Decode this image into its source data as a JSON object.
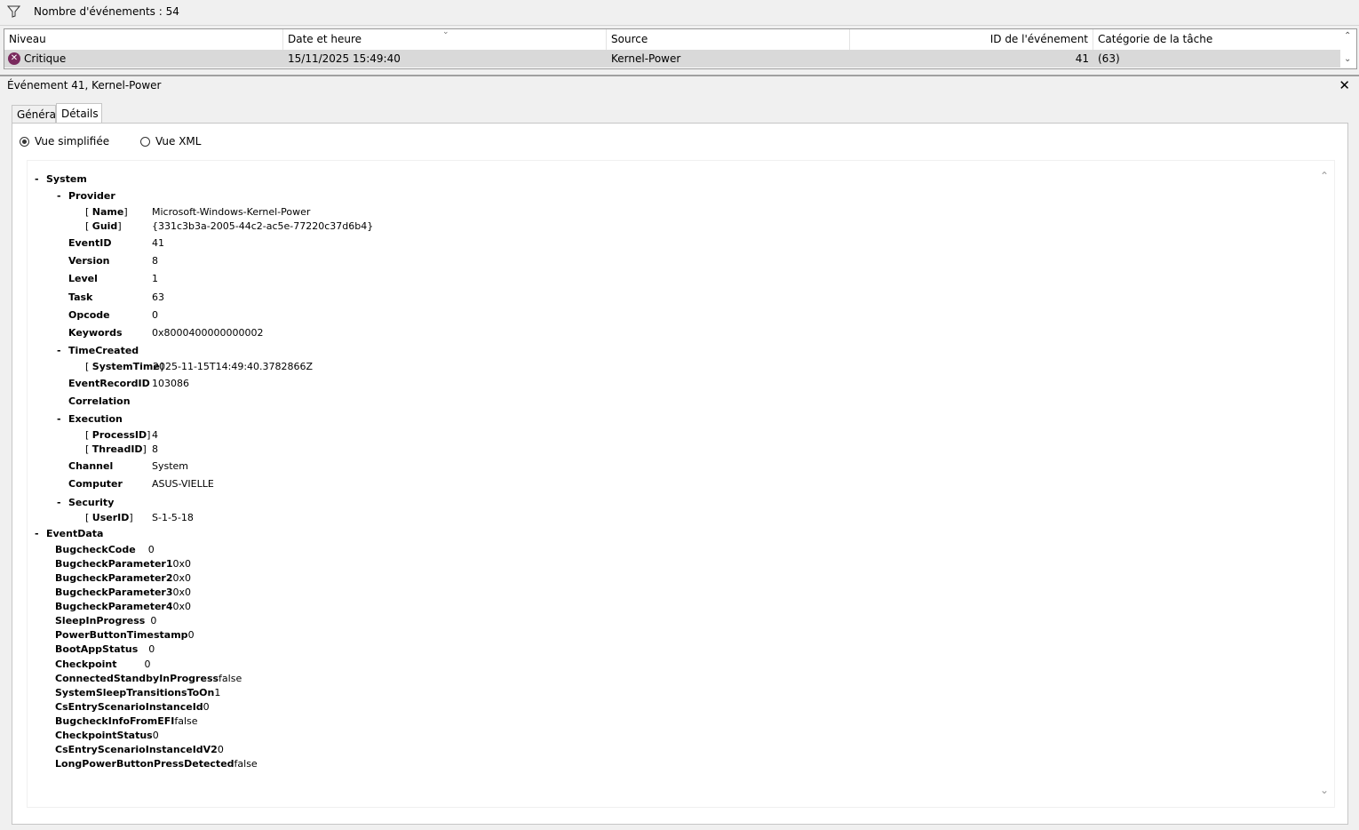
{
  "filter_bar": {
    "event_count": "Nombre d'événements : 54"
  },
  "grid": {
    "headers": [
      "Niveau",
      "Date et heure",
      "Source",
      "ID de l'événement",
      "Catégorie de la tâche"
    ],
    "row": {
      "level": "Critique",
      "datetime": "15/11/2025 15:49:40",
      "source": "Kernel-Power",
      "event_id": "41",
      "task_category": "(63)"
    }
  },
  "detail": {
    "title": "Événement 41, Kernel-Power",
    "tabs": [
      "Général",
      "Détails"
    ],
    "view_simple": "Vue simplifiée",
    "view_xml": "Vue XML",
    "system": {
      "label": "System",
      "provider_label": "Provider",
      "name_key": "Name",
      "name_val": "Microsoft-Windows-Kernel-Power",
      "guid_key": "Guid",
      "guid_val": "{331c3b3a-2005-44c2-ac5e-77220c37d6b4}",
      "fields": [
        {
          "k": "EventID",
          "v": "41"
        },
        {
          "k": "Version",
          "v": "8"
        },
        {
          "k": "Level",
          "v": "1"
        },
        {
          "k": "Task",
          "v": "63"
        },
        {
          "k": "Opcode",
          "v": "0"
        },
        {
          "k": "Keywords",
          "v": "0x8000400000000002"
        }
      ],
      "timecreated_label": "TimeCreated",
      "systemtime_key": "SystemTime",
      "systemtime_val": "2025-11-15T14:49:40.3782866Z",
      "eventrecordid_key": "EventRecordID",
      "eventrecordid_val": "103086",
      "correlation_label": "Correlation",
      "execution_label": "Execution",
      "processid_key": "ProcessID",
      "processid_val": "4",
      "threadid_key": "ThreadID",
      "threadid_val": "8",
      "channel_key": "Channel",
      "channel_val": "System",
      "computer_key": "Computer",
      "computer_val": "ASUS-VIELLE",
      "security_label": "Security",
      "userid_key": "UserID",
      "userid_val": "S-1-5-18"
    },
    "eventdata": {
      "label": "EventData",
      "items": [
        {
          "k": "BugcheckCode",
          "v": "0"
        },
        {
          "k": "BugcheckParameter1",
          "v": "0x0"
        },
        {
          "k": "BugcheckParameter2",
          "v": "0x0"
        },
        {
          "k": "BugcheckParameter3",
          "v": "0x0"
        },
        {
          "k": "BugcheckParameter4",
          "v": "0x0"
        },
        {
          "k": "SleepInProgress",
          "v": "0"
        },
        {
          "k": "PowerButtonTimestamp",
          "v": "0"
        },
        {
          "k": "BootAppStatus",
          "v": "0"
        },
        {
          "k": "Checkpoint",
          "v": "0"
        },
        {
          "k": "ConnectedStandbyInProgress",
          "v": "false"
        },
        {
          "k": "SystemSleepTransitionsToOn",
          "v": "1"
        },
        {
          "k": "CsEntryScenarioInstanceId",
          "v": "0"
        },
        {
          "k": "BugcheckInfoFromEFI",
          "v": "false"
        },
        {
          "k": "CheckpointStatus",
          "v": "0"
        },
        {
          "k": "CsEntryScenarioInstanceIdV2",
          "v": "0"
        },
        {
          "k": "LongPowerButtonPressDetected",
          "v": "false"
        }
      ]
    }
  }
}
